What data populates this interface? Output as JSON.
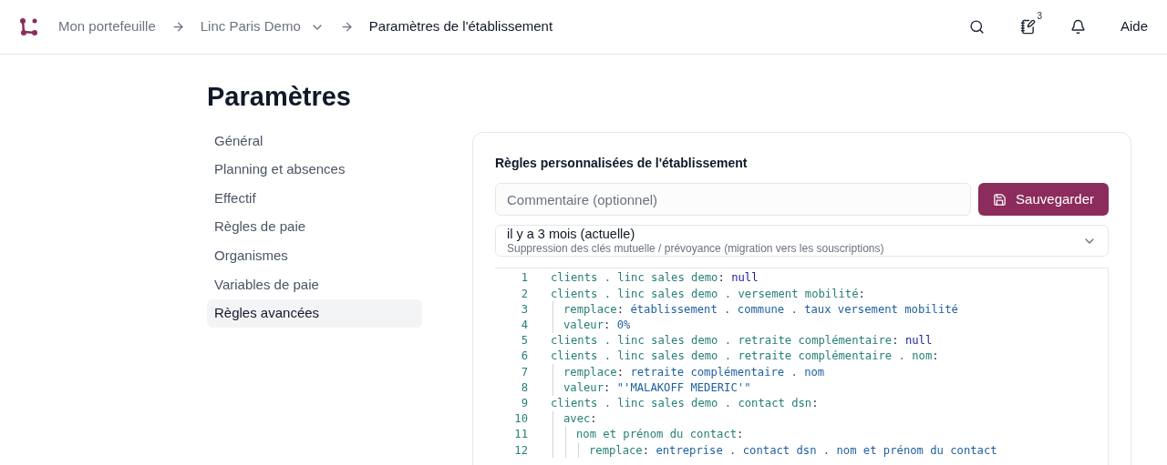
{
  "breadcrumb": [
    {
      "label": "Mon portefeuille",
      "kind": "link"
    },
    {
      "label": "Linc Paris Demo",
      "kind": "dropdown"
    },
    {
      "label": "Paramètres de l'établissement",
      "kind": "current"
    }
  ],
  "header": {
    "notes_badge": "3",
    "help": "Aide"
  },
  "page_title": "Paramètres",
  "sidebar": {
    "items": [
      {
        "label": "Général",
        "selected": false
      },
      {
        "label": "Planning et absences",
        "selected": false
      },
      {
        "label": "Effectif",
        "selected": false
      },
      {
        "label": "Règles de paie",
        "selected": false
      },
      {
        "label": "Organismes",
        "selected": false
      },
      {
        "label": "Variables de paie",
        "selected": false
      },
      {
        "label": "Règles avancées",
        "selected": true
      }
    ]
  },
  "card": {
    "title": "Règles personnalisées de l'établissement",
    "comment": {
      "placeholder": "Commentaire (optionnel)"
    },
    "save_button": "Sauvegarder",
    "version": {
      "label": "il y a 3 mois (actuelle)",
      "description": "Suppression des clés mutuelle / prévoyance (migration vers les souscriptions)"
    },
    "code": [
      {
        "number": "1",
        "tokens": [
          {
            "kind": "key",
            "text": "clients . linc sales demo"
          },
          {
            "kind": "punct",
            "text": ": "
          },
          {
            "kind": "null",
            "text": "null"
          }
        ]
      },
      {
        "number": "2",
        "tokens": [
          {
            "kind": "key",
            "text": "clients . linc sales demo . versement mobilité"
          },
          {
            "kind": "punct",
            "text": ":"
          }
        ],
        "children": [
          {
            "number": "3",
            "tokens": [
              {
                "kind": "key",
                "text": "remplace"
              },
              {
                "kind": "punct",
                "text": ": "
              },
              {
                "kind": "value",
                "text": "établissement . commune . taux versement mobilité"
              }
            ]
          },
          {
            "number": "4",
            "tokens": [
              {
                "kind": "key",
                "text": "valeur"
              },
              {
                "kind": "punct",
                "text": ": "
              },
              {
                "kind": "value",
                "text": "0%"
              }
            ]
          }
        ]
      },
      {
        "number": "5",
        "tokens": [
          {
            "kind": "key",
            "text": "clients . linc sales demo . retraite complémentaire"
          },
          {
            "kind": "punct",
            "text": ": "
          },
          {
            "kind": "null",
            "text": "null"
          }
        ]
      },
      {
        "number": "6",
        "tokens": [
          {
            "kind": "key",
            "text": "clients . linc sales demo . retraite complémentaire . nom"
          },
          {
            "kind": "punct",
            "text": ":"
          }
        ],
        "children": [
          {
            "number": "7",
            "tokens": [
              {
                "kind": "key",
                "text": "remplace"
              },
              {
                "kind": "punct",
                "text": ": "
              },
              {
                "kind": "value",
                "text": "retraite complémentaire . nom"
              }
            ]
          },
          {
            "number": "8",
            "tokens": [
              {
                "kind": "key",
                "text": "valeur"
              },
              {
                "kind": "punct",
                "text": ": "
              },
              {
                "kind": "value",
                "text": "\"'MALAKOFF MEDERIC'\""
              }
            ]
          }
        ]
      },
      {
        "number": "9",
        "tokens": [
          {
            "kind": "key",
            "text": "clients . linc sales demo . contact dsn"
          },
          {
            "kind": "punct",
            "text": ":"
          }
        ],
        "children": [
          {
            "number": "10",
            "tokens": [
              {
                "kind": "key",
                "text": "avec"
              },
              {
                "kind": "punct",
                "text": ":"
              }
            ],
            "children": [
              {
                "number": "11",
                "tokens": [
                  {
                    "kind": "key",
                    "text": "nom et prénom du contact"
                  },
                  {
                    "kind": "punct",
                    "text": ":"
                  }
                ],
                "children": [
                  {
                    "number": "12",
                    "tokens": [
                      {
                        "kind": "key",
                        "text": "remplace"
                      },
                      {
                        "kind": "punct",
                        "text": ": "
                      },
                      {
                        "kind": "value",
                        "text": "entreprise . contact dsn . nom et prénom du contact"
                      }
                    ]
                  }
                ]
              }
            ]
          }
        ]
      }
    ]
  }
}
